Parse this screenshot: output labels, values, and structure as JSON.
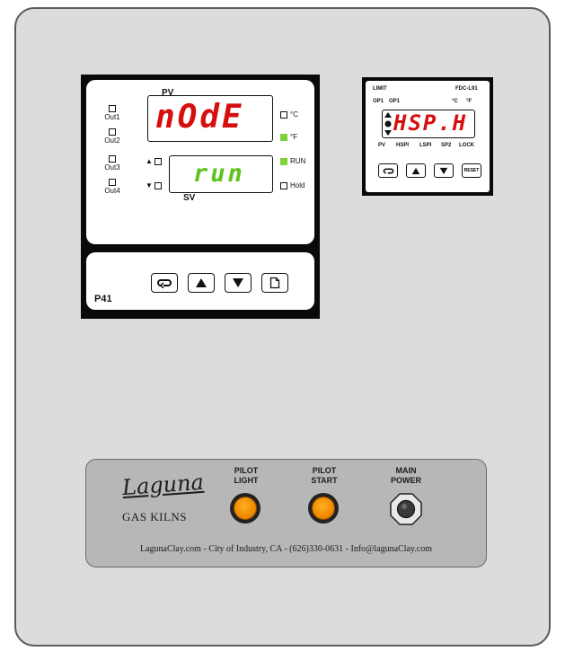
{
  "p41": {
    "pv_label": "PV",
    "sv_label": "SV",
    "pv_display": "nOdE",
    "sv_display": "run",
    "outputs": [
      "Out1",
      "Out2",
      "Out3",
      "Out4"
    ],
    "indicators": {
      "celsius": "°C",
      "fahrenheit": "°F",
      "run": "RUN",
      "hold": "Hold"
    },
    "model": "P41"
  },
  "l91": {
    "limit": "LIMIT",
    "model": "FDC-L91",
    "op1a": "OP1",
    "op1b": "OP1",
    "celsius": "°C",
    "fahrenheit": "°F",
    "display": "HSP.H",
    "bottom_labels": [
      "PV",
      "HSPI",
      "LSPI",
      "SP2",
      "LOCK"
    ],
    "reset": "RESET"
  },
  "plate": {
    "logo_script": "Laguna",
    "logo_sub": "GAS KILNS",
    "pilot_light": "PILOT\nLIGHT",
    "pilot_start": "PILOT\nSTART",
    "main_power": "MAIN\nPOWER",
    "footer": "LagunaClay.com - City of Industry, CA - (626)330-0631 - Info@lagunaClay.com"
  },
  "colors": {
    "red_display": "#d60e0e",
    "green_display": "#5fc21e",
    "led_green": "#7fd13b",
    "button_orange": "#f08a00"
  },
  "icons": [
    "cycle-icon",
    "up-arrow-icon",
    "down-arrow-icon",
    "page-icon"
  ]
}
